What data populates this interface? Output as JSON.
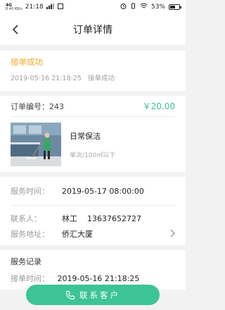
{
  "status_bar": {
    "network": "4G",
    "speed": "8.40 KB/s",
    "time": "21:18",
    "battery": "53%",
    "battery_level": 0.53
  },
  "nav": {
    "title": "订单详情",
    "back_icon": "chevron-left-icon"
  },
  "order_status": {
    "title": "接单成功",
    "datetime": "2019-05-16 21:18:25",
    "note": "接单成功"
  },
  "order": {
    "number_label": "订单编号：243",
    "price": "￥20.00",
    "service_name": "日常保洁",
    "service_unit": "单次/100㎡以下"
  },
  "info": {
    "service_time_label": "服务时间：",
    "service_time": "2019-05-17 08:00:00",
    "contact_label": "联系人：",
    "contact_name": "林工",
    "contact_phone": "13637652727",
    "address_label": "服务地址：",
    "address": "侨汇大厦"
  },
  "record": {
    "title": "服务记录",
    "accept_label": "接单时间：",
    "accept_time": "2019-05-16 21:18:25"
  },
  "actions": {
    "contact_label": "联系客户"
  },
  "colors": {
    "accent": "#3cc496",
    "status": "#f5a623"
  }
}
